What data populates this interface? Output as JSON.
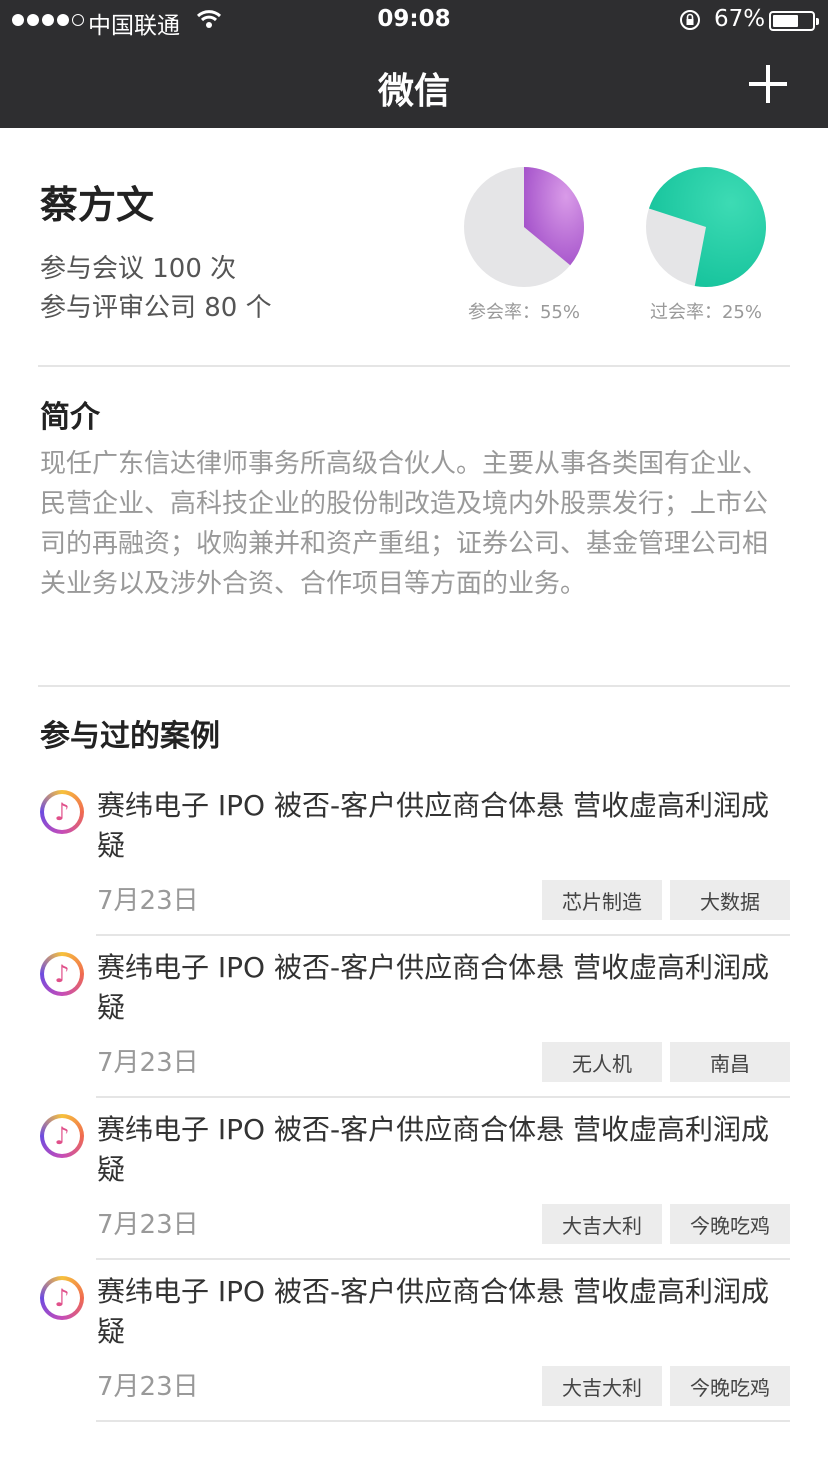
{
  "status_bar": {
    "carrier": "中国联通",
    "time": "09:08",
    "battery_pct": "67%",
    "battery_level": 0.67
  },
  "nav": {
    "title": "微信",
    "add_icon": "plus-icon"
  },
  "profile": {
    "name": "蔡方文",
    "meetings": "参与会议 100 次",
    "companies": "参与评审公司 80 个",
    "attendance": {
      "label": "参会率：55%",
      "value": 0.55,
      "color": "#b062d2"
    },
    "pass": {
      "label": "过会率：25%",
      "value": 0.25,
      "color": "#1dc9a2"
    }
  },
  "intro": {
    "title": "简介",
    "text": "现任广东信达律师事务所高级合伙人。主要从事各类国有企业、民营企业、高科技企业的股份制改造及境内外股票发行；上市公司的再融资；收购兼并和资产重组；证券公司、基金管理公司相关业务以及涉外合资、合作项目等方面的业务。"
  },
  "cases": {
    "title": "参与过的案例",
    "items": [
      {
        "title": "赛纬电子 IPO 被否-客户供应商合体悬  营收虚高利润成疑",
        "date": "7月23日",
        "tags": [
          "芯片制造",
          "大数据"
        ]
      },
      {
        "title": "赛纬电子 IPO 被否-客户供应商合体悬  营收虚高利润成疑",
        "date": "7月23日",
        "tags": [
          "无人机",
          "南昌"
        ]
      },
      {
        "title": "赛纬电子 IPO 被否-客户供应商合体悬  营收虚高利润成疑",
        "date": "7月23日",
        "tags": [
          "大吉大利",
          "今晚吃鸡"
        ]
      },
      {
        "title": "赛纬电子 IPO 被否-客户供应商合体悬  营收虚高利润成疑",
        "date": "7月23日",
        "tags": [
          "大吉大利",
          "今晚吃鸡"
        ]
      }
    ]
  }
}
